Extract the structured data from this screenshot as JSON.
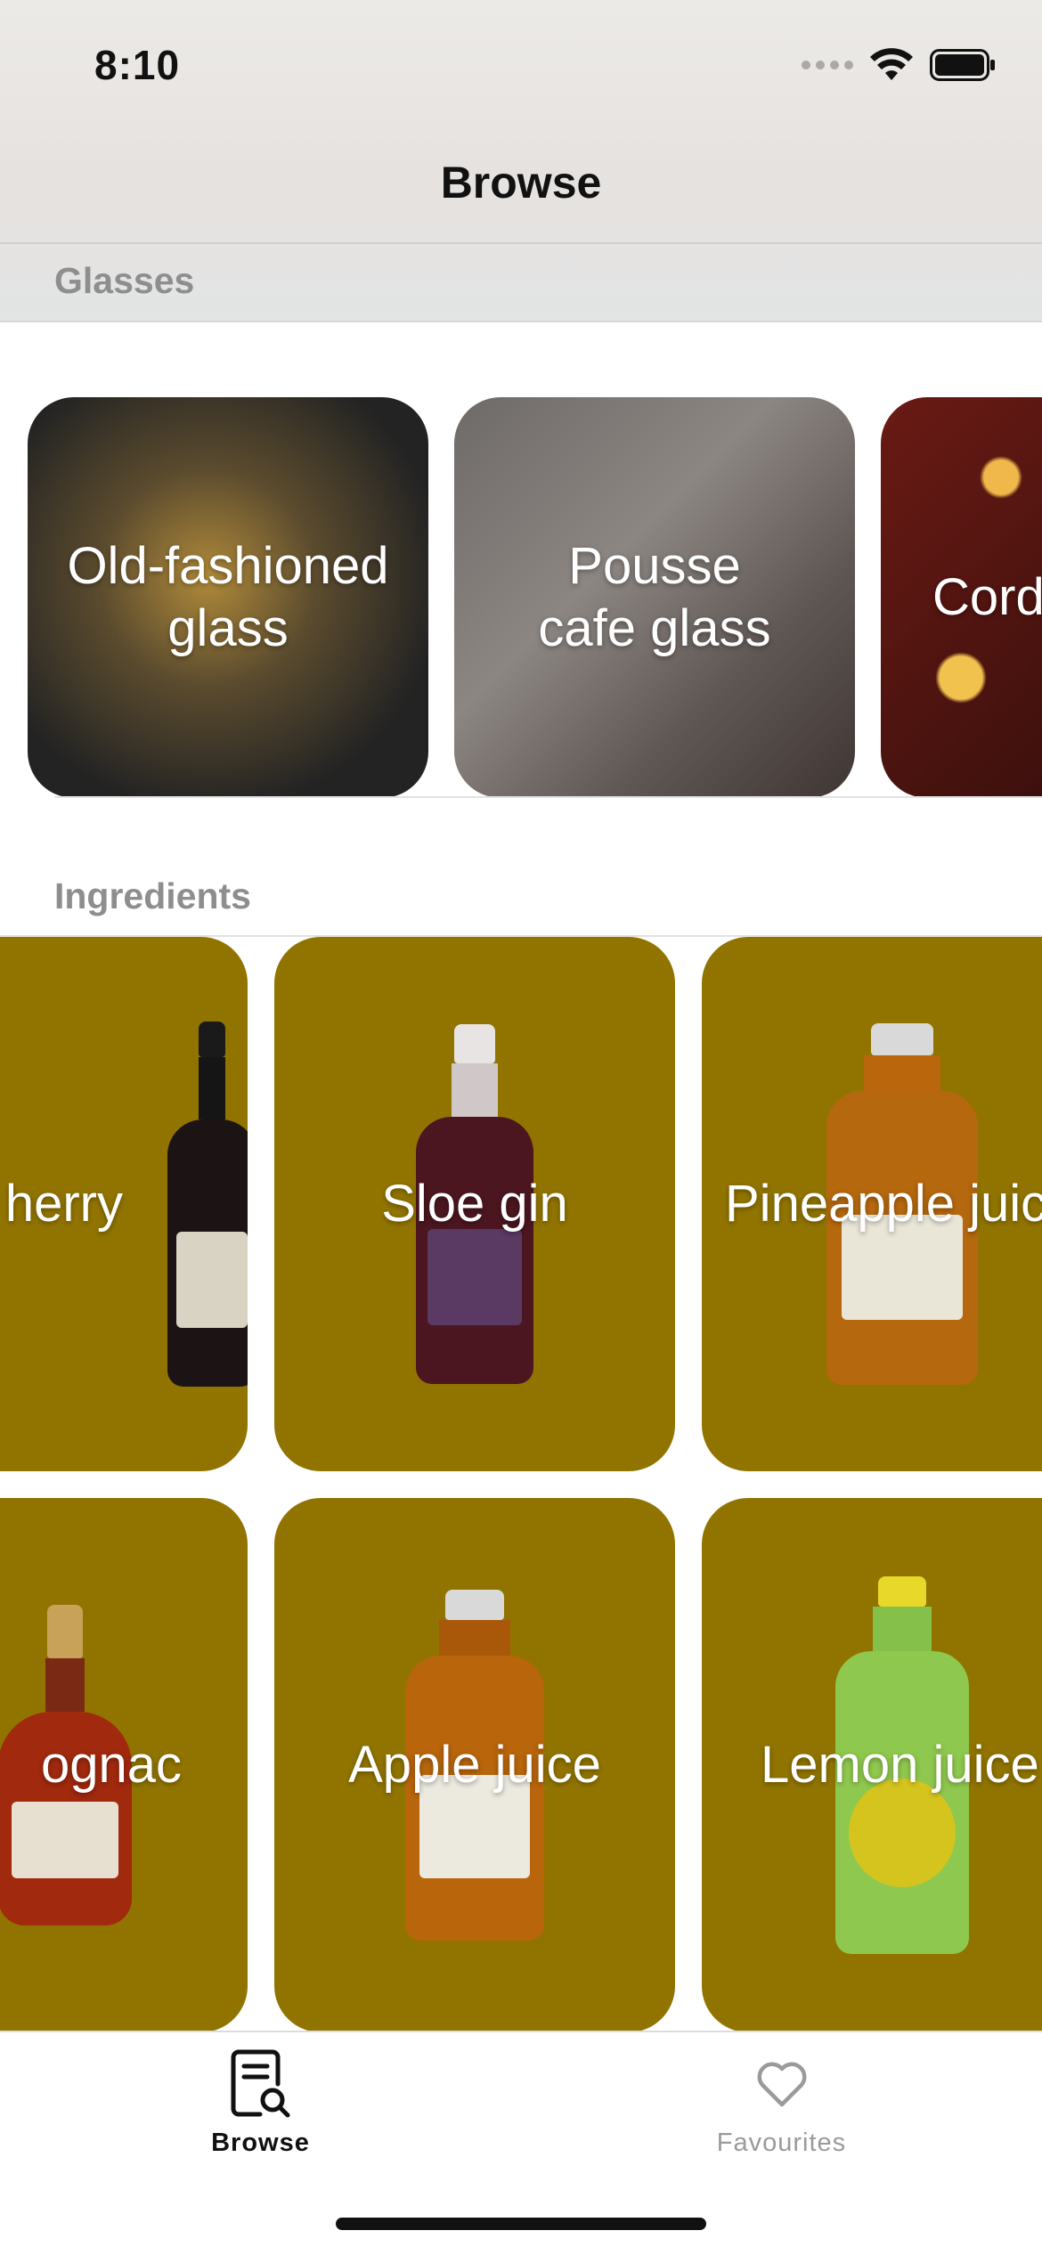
{
  "status_bar": {
    "time": "8:10"
  },
  "nav": {
    "title": "Browse"
  },
  "sections": {
    "glasses_header": "Glasses",
    "ingredients_header": "Ingredients"
  },
  "glasses": [
    {
      "label": "Old-fashioned\nglass"
    },
    {
      "label": "Pousse\ncafe glass"
    },
    {
      "label": "Cord"
    }
  ],
  "ingredients_row1": [
    {
      "label": "herry",
      "bottle": "dark-wine"
    },
    {
      "label": "Sloe gin",
      "bottle": "sloe-gin"
    },
    {
      "label": "Pineapple juic",
      "bottle": "juice-orange"
    }
  ],
  "ingredients_row2": [
    {
      "label": "ognac",
      "bottle": "cognac"
    },
    {
      "label": "Apple juice",
      "bottle": "juice-amber"
    },
    {
      "label": "Lemon juice",
      "bottle": "juice-green"
    }
  ],
  "tabs": [
    {
      "label": "Browse",
      "icon": "browse-icon",
      "selected": true
    },
    {
      "label": "Favourites",
      "icon": "heart-icon",
      "selected": false
    }
  ],
  "colors": {
    "ingredient_card": "#917400",
    "header_text": "#8e8e8e",
    "tab_selected": "#111111",
    "tab_unselected": "#9a9a9a"
  }
}
